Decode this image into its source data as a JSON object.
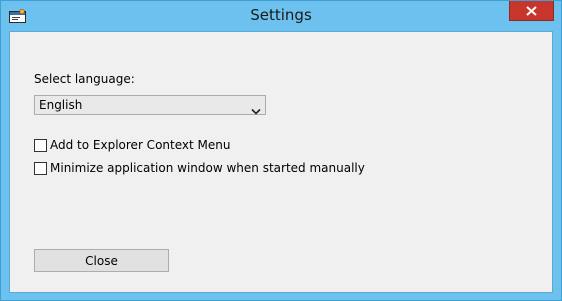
{
  "window": {
    "title": "Settings",
    "icons": {
      "app": "settings-app-icon",
      "close": "close-icon"
    },
    "colors": {
      "frame": "#6cc1ee",
      "close_button": "#c7352b",
      "client": "#f0f0f0"
    }
  },
  "settings": {
    "language_label": "Select language:",
    "language_value": "English",
    "checkboxes": [
      {
        "label": "Add to Explorer Context Menu",
        "checked": false
      },
      {
        "label": "Minimize application window when started manually",
        "checked": false
      }
    ],
    "close_button_label": "Close"
  }
}
